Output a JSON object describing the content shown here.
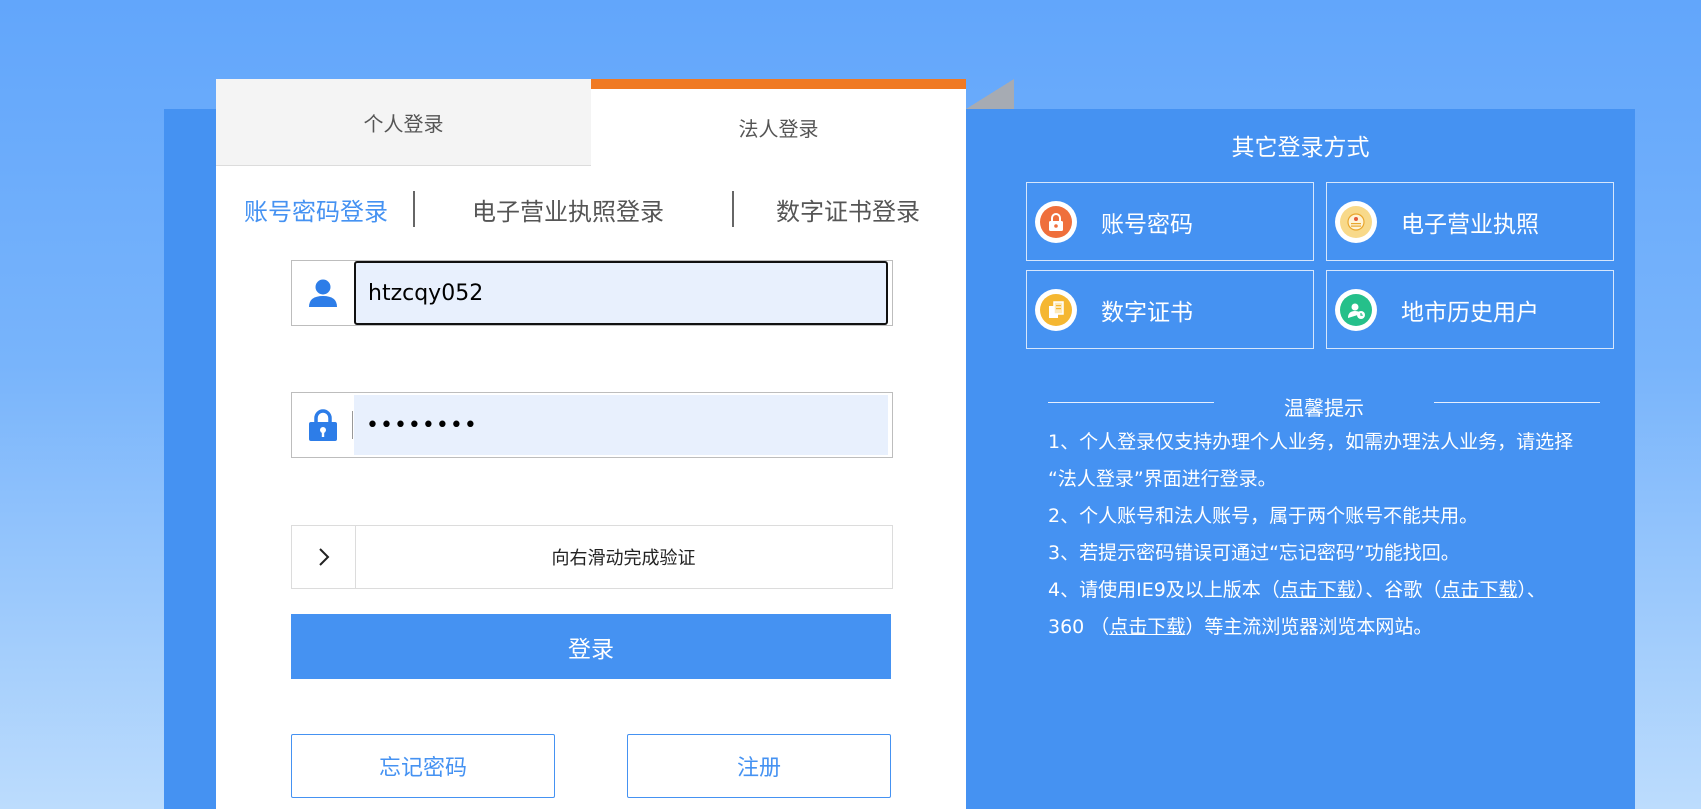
{
  "tabs": {
    "personal": "个人登录",
    "legal": "法人登录"
  },
  "subtabs": {
    "account": "账号密码登录",
    "license": "电子营业执照登录",
    "cert": "数字证书登录"
  },
  "form": {
    "username_value": "htzcqy052",
    "password_value": "••••••••",
    "slider_text": "向右滑动完成验证",
    "login_label": "登录",
    "forgot_label": "忘记密码",
    "register_label": "注册"
  },
  "other": {
    "title": "其它登录方式",
    "options": [
      {
        "label": "账号密码",
        "icon": "lock-icon",
        "color": "#ef6f3c"
      },
      {
        "label": "电子营业执照",
        "icon": "license-icon",
        "color": "#f6c243"
      },
      {
        "label": "数字证书",
        "icon": "certificate-icon",
        "color": "#f5b731"
      },
      {
        "label": "地市历史用户",
        "icon": "history-user-icon",
        "color": "#25c08a"
      }
    ]
  },
  "tips": {
    "heading": "温馨提示",
    "line1": "1、个人登录仅支持办理个人业务，如需办理法人业务，请选择",
    "line1b": "“法人登录”界面进行登录。",
    "line2": "2、个人账号和法人账号，属于两个账号不能共用。",
    "line3": "3、若提示密码错误可通过“忘记密码”功能找回。",
    "line4a": "4、请使用IE9及以上版本（",
    "link1": "点击下载",
    "line4b": "）、谷歌（",
    "link2": "点击下载",
    "line4c": "）、",
    "line5a": "360 （",
    "link3": "点击下载",
    "line5b": "）等主流浏览器浏览本网站。"
  },
  "colors": {
    "accent": "#4592f2",
    "active_tab": "#f07a23"
  }
}
